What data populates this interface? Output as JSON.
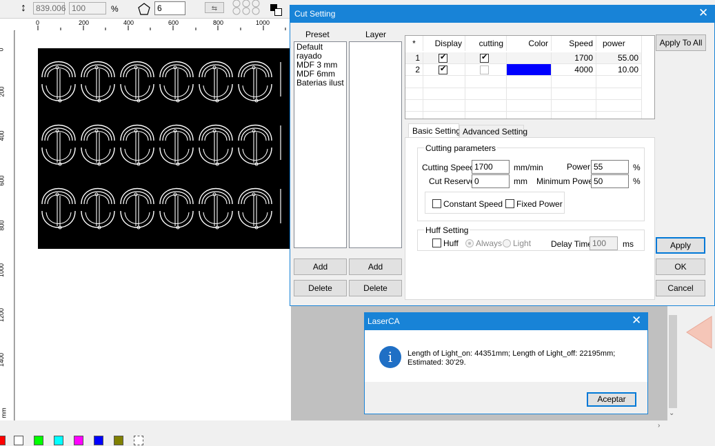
{
  "toolbar": {
    "height_value": "839.006",
    "scale_value": "100",
    "percent": "%",
    "polygon_sides": "6"
  },
  "ruler": {
    "top_ticks": [
      "0",
      "200",
      "400",
      "600",
      "800",
      "1000"
    ],
    "left_ticks": [
      "0",
      "200",
      "400",
      "600",
      "800",
      "1000",
      "1200",
      "1400",
      "mm"
    ]
  },
  "cut_dialog": {
    "title": "Cut Setting",
    "preset_label": "Preset",
    "layer_label": "Layer",
    "presets": [
      "Default",
      "rayado",
      "MDF 3 mm",
      "MDF 6mm",
      "Baterias ilust cc"
    ],
    "add_preset": "Add",
    "add_layer": "Add",
    "delete_preset": "Delete",
    "delete_layer": "Delete",
    "table": {
      "headers": [
        "*",
        "Display",
        "cutting",
        "Color",
        "Speed",
        "power le..."
      ],
      "rows": [
        {
          "index": "1",
          "display": true,
          "cutting": true,
          "color": "#ffffff",
          "speed": "1700",
          "power": "55.00"
        },
        {
          "index": "2",
          "display": true,
          "cutting": false,
          "color": "#0000ff",
          "speed": "4000",
          "power": "10.00"
        }
      ]
    },
    "apply_all": "Apply To All",
    "tab_basic": "Basic Setting",
    "tab_advanced": "Advanced Setting",
    "cutting_params_label": "Cutting parameters",
    "cutting_speed_label": "Cutting Speed",
    "cutting_speed_value": "1700",
    "cutting_speed_unit": "mm/min",
    "power_label": "Power",
    "power_value": "55",
    "power_unit": "%",
    "cut_reserve_label": "Cut Reserve",
    "cut_reserve_value": "0",
    "cut_reserve_unit": "mm",
    "min_power_label": "Minimum Power",
    "min_power_value": "50",
    "min_power_unit": "%",
    "constant_speed": "Constant Speed",
    "fixed_power": "Fixed Power",
    "huff_setting_label": "Huff Setting",
    "huff": "Huff",
    "always": "Always",
    "light": "Light",
    "delay_label": "Delay Time",
    "delay_value": "100",
    "delay_unit": "ms",
    "apply": "Apply",
    "ok": "OK",
    "cancel": "Cancel"
  },
  "message_box": {
    "title": "LaserCA",
    "line1": "Length of Light_on: 44351mm; Length of Light_off: 22195mm;",
    "line2": "Estimated: 30'29.",
    "accept": "Aceptar"
  },
  "palette": [
    "#ff0000",
    "#ffffff",
    "#00ff00",
    "#00ffff",
    "#ff00ff",
    "#0000ff",
    "#808000"
  ]
}
